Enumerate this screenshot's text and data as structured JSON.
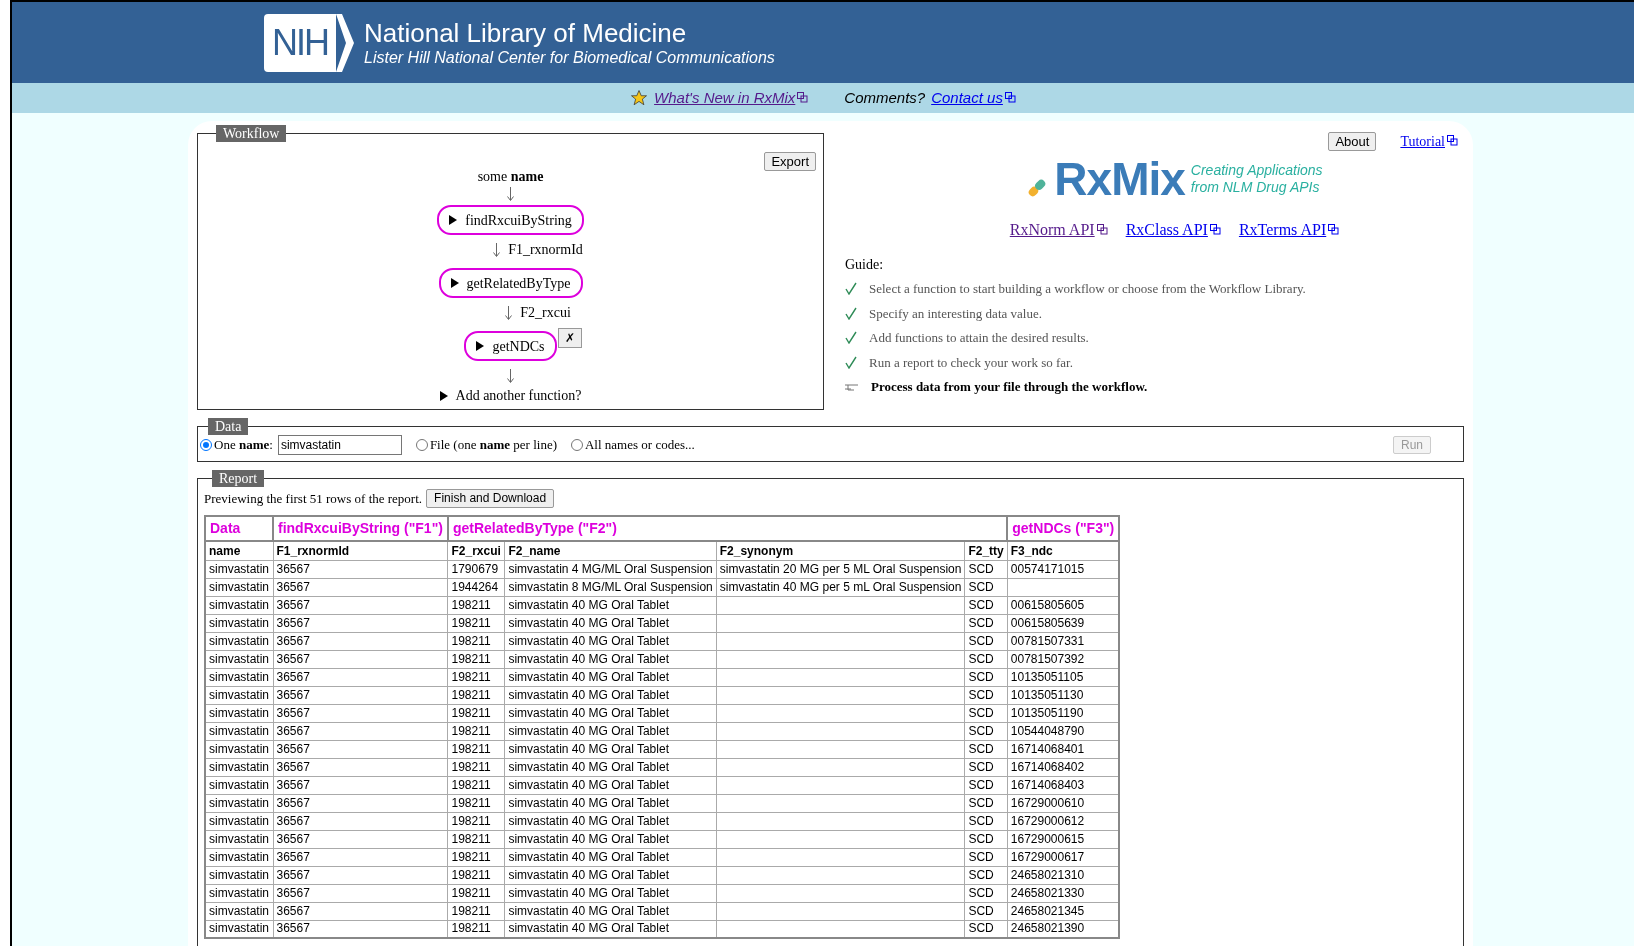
{
  "header": {
    "logo_text": "NIH",
    "title": "National Library of Medicine",
    "subtitle": "Lister Hill National Center for Biomedical Communications"
  },
  "nav": {
    "whats_new": "What's New in RxMix",
    "comments": "Comments?",
    "contact": "Contact us"
  },
  "workflow": {
    "legend": "Workflow",
    "export": "Export",
    "input_label": "some **name**",
    "steps": [
      {
        "function": "findRxcuiByString",
        "output": "F1_rxnormId"
      },
      {
        "function": "getRelatedByType",
        "output": "F2_rxcui"
      },
      {
        "function": "getNDCs",
        "remove_label": "✗"
      }
    ],
    "add_function": "Add another function?"
  },
  "side": {
    "about": "About",
    "tutorial": "Tutorial",
    "logo_text": "RxMix",
    "tagline": [
      "Creating Applications",
      "from NLM Drug APIs"
    ],
    "api_links": [
      {
        "label": "RxNorm API",
        "visited": true
      },
      {
        "label": "RxClass API",
        "visited": false
      },
      {
        "label": "RxTerms API",
        "visited": false
      }
    ],
    "guide_title": "Guide:",
    "guide": [
      {
        "kind": "done",
        "text": "Select a function to start building a workflow or choose from the Workflow Library."
      },
      {
        "kind": "done",
        "text": "Specify an interesting data value."
      },
      {
        "kind": "done",
        "text": "Add functions to attain the desired results."
      },
      {
        "kind": "done",
        "text": "Run a report to check your work so far."
      },
      {
        "kind": "current",
        "text": "Process data from your file through the workflow."
      }
    ]
  },
  "data": {
    "legend": "Data",
    "options": [
      {
        "label": "One **name**:",
        "selected": true,
        "value": "simvastatin"
      },
      {
        "label": "File (one **name** per line)",
        "selected": false
      },
      {
        "label": "All names or codes...",
        "selected": false
      }
    ],
    "run": "Run",
    "run_disabled": true
  },
  "report": {
    "legend": "Report",
    "preview": "Previewing the first 51 rows of the report.",
    "download": "Finish and Download",
    "groups": [
      {
        "label": "Data",
        "columns": [
          "name"
        ]
      },
      {
        "label": "findRxcuiByString (\"F1\")",
        "columns": [
          "F1_rxnormId"
        ]
      },
      {
        "label": "getRelatedByType (\"F2\")",
        "columns": [
          "F2_rxcui",
          "F2_name",
          "F2_synonym",
          "F2_tty"
        ]
      },
      {
        "label": "getNDCs (\"F3\")",
        "columns": [
          "F3_ndc"
        ]
      }
    ],
    "rows": [
      [
        "simvastatin",
        "36567",
        "1790679",
        "simvastatin 4 MG/ML Oral Suspension",
        "simvastatin 20 MG per 5 ML Oral Suspension",
        "SCD",
        "00574171015"
      ],
      [
        "simvastatin",
        "36567",
        "1944264",
        "simvastatin 8 MG/ML Oral Suspension",
        "simvastatin 40 MG per 5 mL Oral Suspension",
        "SCD",
        ""
      ],
      [
        "simvastatin",
        "36567",
        "198211",
        "simvastatin 40 MG Oral Tablet",
        "",
        "SCD",
        "00615805605"
      ],
      [
        "simvastatin",
        "36567",
        "198211",
        "simvastatin 40 MG Oral Tablet",
        "",
        "SCD",
        "00615805639"
      ],
      [
        "simvastatin",
        "36567",
        "198211",
        "simvastatin 40 MG Oral Tablet",
        "",
        "SCD",
        "00781507331"
      ],
      [
        "simvastatin",
        "36567",
        "198211",
        "simvastatin 40 MG Oral Tablet",
        "",
        "SCD",
        "00781507392"
      ],
      [
        "simvastatin",
        "36567",
        "198211",
        "simvastatin 40 MG Oral Tablet",
        "",
        "SCD",
        "10135051105"
      ],
      [
        "simvastatin",
        "36567",
        "198211",
        "simvastatin 40 MG Oral Tablet",
        "",
        "SCD",
        "10135051130"
      ],
      [
        "simvastatin",
        "36567",
        "198211",
        "simvastatin 40 MG Oral Tablet",
        "",
        "SCD",
        "10135051190"
      ],
      [
        "simvastatin",
        "36567",
        "198211",
        "simvastatin 40 MG Oral Tablet",
        "",
        "SCD",
        "10544048790"
      ],
      [
        "simvastatin",
        "36567",
        "198211",
        "simvastatin 40 MG Oral Tablet",
        "",
        "SCD",
        "16714068401"
      ],
      [
        "simvastatin",
        "36567",
        "198211",
        "simvastatin 40 MG Oral Tablet",
        "",
        "SCD",
        "16714068402"
      ],
      [
        "simvastatin",
        "36567",
        "198211",
        "simvastatin 40 MG Oral Tablet",
        "",
        "SCD",
        "16714068403"
      ],
      [
        "simvastatin",
        "36567",
        "198211",
        "simvastatin 40 MG Oral Tablet",
        "",
        "SCD",
        "16729000610"
      ],
      [
        "simvastatin",
        "36567",
        "198211",
        "simvastatin 40 MG Oral Tablet",
        "",
        "SCD",
        "16729000612"
      ],
      [
        "simvastatin",
        "36567",
        "198211",
        "simvastatin 40 MG Oral Tablet",
        "",
        "SCD",
        "16729000615"
      ],
      [
        "simvastatin",
        "36567",
        "198211",
        "simvastatin 40 MG Oral Tablet",
        "",
        "SCD",
        "16729000617"
      ],
      [
        "simvastatin",
        "36567",
        "198211",
        "simvastatin 40 MG Oral Tablet",
        "",
        "SCD",
        "24658021310"
      ],
      [
        "simvastatin",
        "36567",
        "198211",
        "simvastatin 40 MG Oral Tablet",
        "",
        "SCD",
        "24658021330"
      ],
      [
        "simvastatin",
        "36567",
        "198211",
        "simvastatin 40 MG Oral Tablet",
        "",
        "SCD",
        "24658021345"
      ],
      [
        "simvastatin",
        "36567",
        "198211",
        "simvastatin 40 MG Oral Tablet",
        "",
        "SCD",
        "24658021390"
      ]
    ]
  }
}
